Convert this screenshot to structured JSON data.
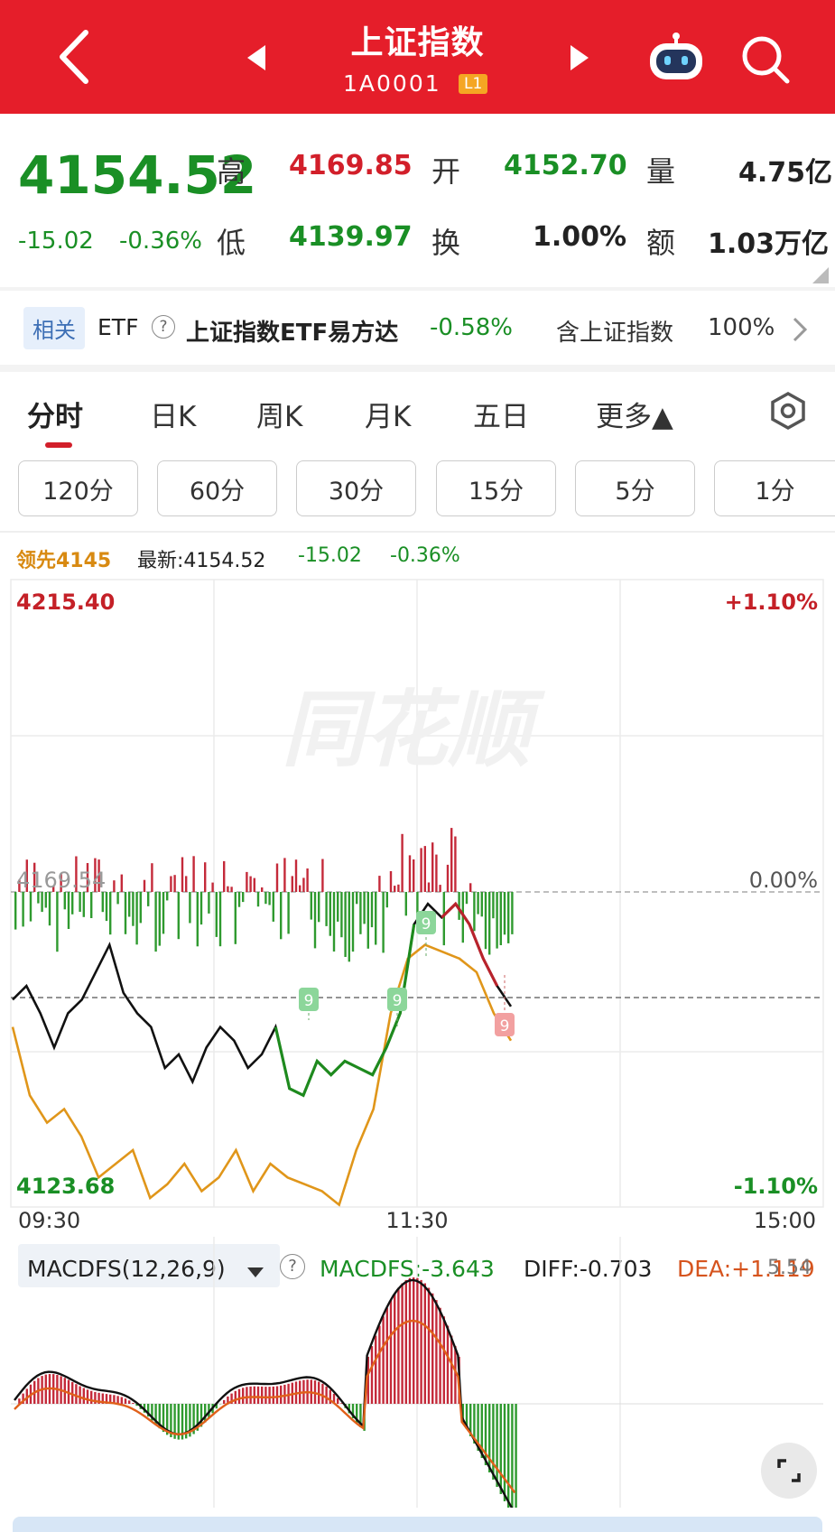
{
  "header": {
    "title": "上证指数",
    "code": "1A0001",
    "level": "L1"
  },
  "quote": {
    "price": "4154.52",
    "change": "-15.02",
    "change_pct": "-0.36%",
    "high_label": "高",
    "high": "4169.85",
    "open_label": "开",
    "open": "4152.70",
    "volume_label": "量",
    "volume": "4.75亿",
    "low_label": "低",
    "low": "4139.97",
    "turnover_label": "换",
    "turnover": "1.00%",
    "amount_label": "额",
    "amount": "1.03万亿"
  },
  "etf": {
    "tag": "相关",
    "label": "ETF",
    "help": "?",
    "name": "上证指数ETF易方达",
    "change": "-0.58%",
    "contain": "含上证指数",
    "contain_pct": "100%"
  },
  "tabs": [
    "分时",
    "日K",
    "周K",
    "月K",
    "五日",
    "更多▲"
  ],
  "periods": [
    "120分",
    "60分",
    "30分",
    "15分",
    "5分",
    "1分"
  ],
  "info_line": {
    "lead": "领先4145",
    "latest": "最新:4154.52",
    "change": "-15.02",
    "pct": "-0.36%"
  },
  "watermark": "同花顺",
  "chart_data": {
    "type": "line",
    "title": "",
    "y_max": "4215.40",
    "y_mid": "4169.54",
    "y_min": "4123.68",
    "pct_max": "+1.10%",
    "pct_mid": "0.00%",
    "pct_min": "-1.10%",
    "x_ticks": [
      "09:30",
      "11:30",
      "15:00"
    ],
    "ylim": [
      4123.68,
      4215.4
    ],
    "markers": [
      "9",
      "9",
      "9",
      "9"
    ],
    "series": [
      {
        "values": [
          4154,
          4156,
          4152,
          4147,
          4152,
          4154,
          4158,
          4162,
          4155,
          4152,
          4150,
          4144,
          4146,
          4142,
          4147,
          4150,
          4148,
          4144,
          4146,
          4150,
          4141,
          4140,
          4145,
          4143,
          4145,
          4144,
          4143,
          4147,
          4152,
          4165,
          4168,
          4166,
          4168,
          4165,
          4160,
          4156,
          4153
        ]
      },
      {
        "values": [
          4150,
          4140,
          4136,
          4138,
          4134,
          4128,
          4130,
          4132,
          4125,
          4127,
          4130,
          4126,
          4128,
          4132,
          4126,
          4130,
          4128,
          4127,
          4126,
          4124,
          4132,
          4138,
          4152,
          4160,
          4162,
          4161,
          4160,
          4158,
          4152,
          4148
        ]
      }
    ]
  },
  "macd": {
    "indicator": "MACDFS(12,26,9)",
    "help": "?",
    "macdfs": "MACDFS:-3.643",
    "diff": "DIFF:-0.703",
    "dea": "DEA:+1.119",
    "top_value": "5.54"
  },
  "colors": {
    "brand": "#e51e2a",
    "up": "#d21f2a",
    "down": "#1a8f25",
    "lead": "#d88a12"
  }
}
